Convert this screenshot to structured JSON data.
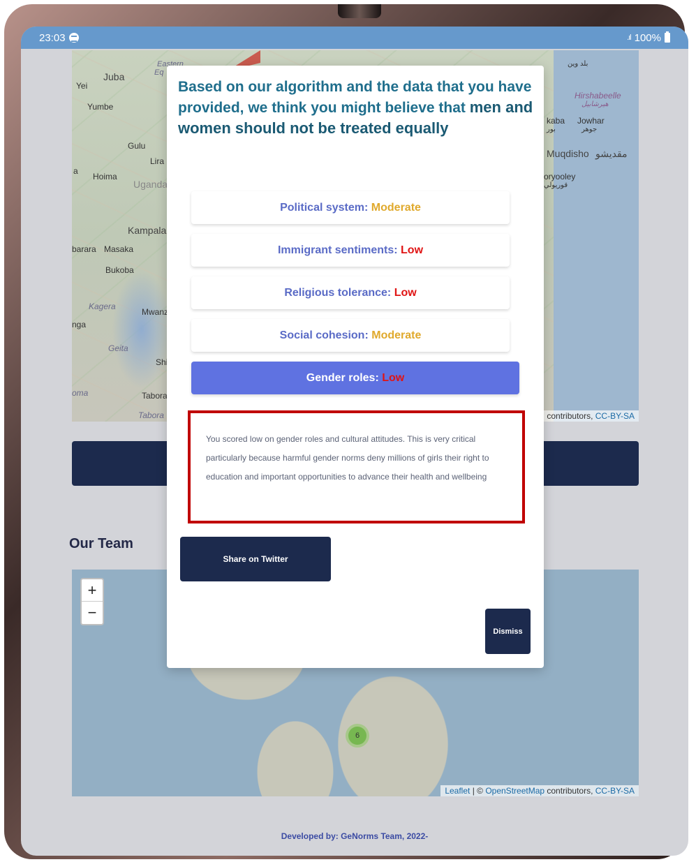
{
  "status_bar": {
    "time": "23:03",
    "signal": ".ıl",
    "battery": "100%"
  },
  "map_top": {
    "labels": [
      "Juba",
      "Eastern",
      "Eq",
      "Yei",
      "Yumbe",
      "Gulu",
      "Lira",
      "Hoima",
      "Uganda",
      "Kampala",
      "barara",
      "Masaka",
      "Bukoba",
      "Kagera",
      "Mwanz",
      "nga",
      "Geita",
      "Shi",
      "oma",
      "Tabora",
      "Tabora",
      "Hirshabeelle",
      "هيرشابيل",
      "kaba",
      "Jowhar",
      "جوهر",
      "بور",
      "Muqdisho",
      "مقديشو",
      "oryooley",
      "قوريولي",
      "بلد وين",
      "a"
    ],
    "attribution_text": "contributors, ",
    "attribution_link": "CC-BY-SA"
  },
  "section_title": "Our Team",
  "map_bottom": {
    "zoom_in": "+",
    "zoom_out": "−",
    "cluster_count": "6",
    "attribution_leaflet": "Leaflet",
    "attribution_sep": " | © ",
    "attribution_osm": "OpenStreetMap",
    "attribution_text": " contributors, ",
    "attribution_link": "CC-BY-SA"
  },
  "footer": "Developed by: GeNorms Team, 2022-",
  "modal": {
    "title_prefix": "Based on our algorithm and the data that you have provided, we think you might believe that ",
    "title_emphasis": "men and women should not be treated equally",
    "scores": [
      {
        "label": "Political system:",
        "value": "Moderate",
        "level": "moderate",
        "active": false
      },
      {
        "label": "Immigrant sentiments:",
        "value": "Low",
        "level": "low",
        "active": false
      },
      {
        "label": "Religious tolerance:",
        "value": "Low",
        "level": "low",
        "active": false
      },
      {
        "label": "Social cohesion:",
        "value": "Moderate",
        "level": "moderate",
        "active": false
      },
      {
        "label": "Gender roles:",
        "value": "Low",
        "level": "low",
        "active": true
      }
    ],
    "description": "You scored low on gender roles and cultural attitudes. This is very critical particularly because harmful gender norms deny millions of girls their right to education and important opportunities to advance their health and wellbeing",
    "share_button": "Share on Twitter",
    "dismiss_button": "Dismiss"
  },
  "colors": {
    "status_bar": "#6699cc",
    "title": "#1f6e8c",
    "score_label": "#5a6bc6",
    "moderate": "#e0a92c",
    "low": "#e01414",
    "active_score_bg": "#5f72e1",
    "highlight_border": "#c00000",
    "navy": "#1c2a4d"
  }
}
